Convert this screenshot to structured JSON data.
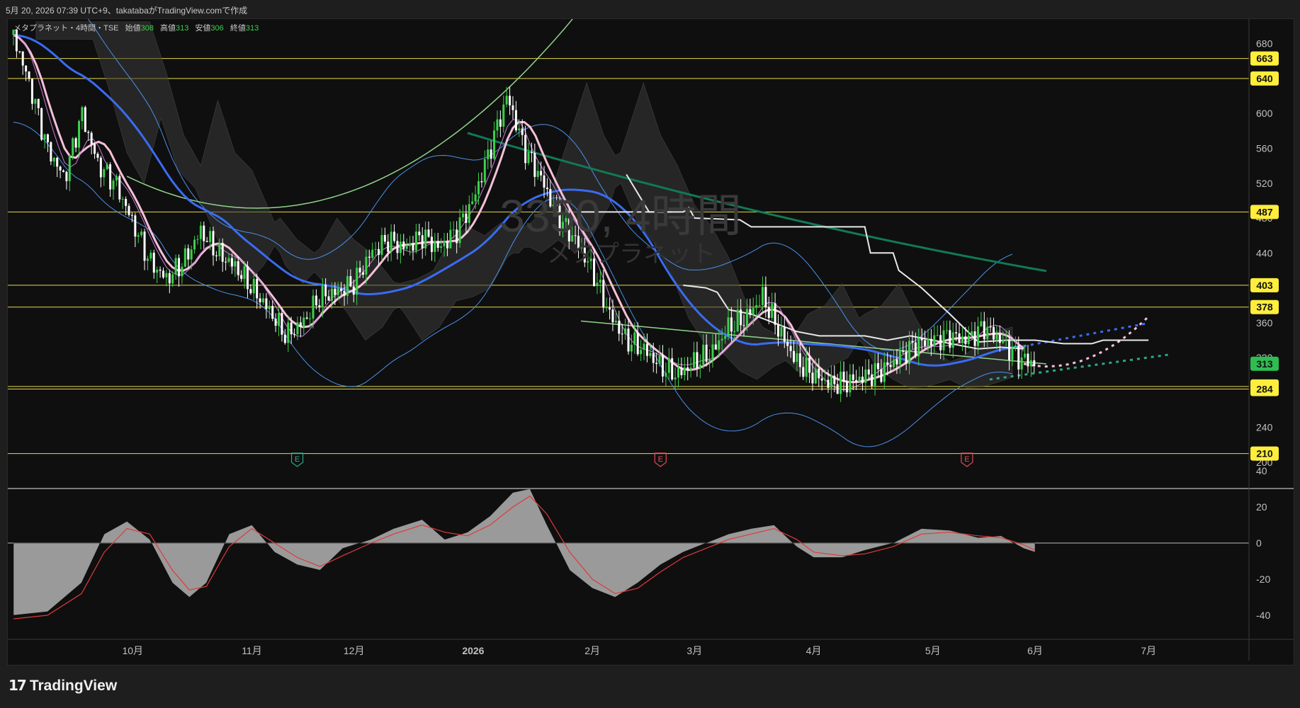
{
  "caption": "5月 20, 2026 07:39 UTC+9、takatabaがTradingView.comで作成",
  "logo": "TradingView",
  "legend": {
    "symbol": "メタプラネット・4時間・TSE",
    "open_label": "始値",
    "open": "308",
    "high_label": "高値",
    "high": "313",
    "low_label": "安値",
    "low": "306",
    "close_label": "終値",
    "close": "313"
  },
  "watermark": {
    "main": "3350, 4時間",
    "sub": "メタプラネット"
  },
  "earnings_marker": "E",
  "colors": {
    "level_line": "#e6d94a",
    "level_label_bg": "#ffee3c",
    "last_price_bg": "#2fbd52",
    "up": "#3bd14a",
    "down": "#ffffff",
    "ma_blue": "#3a6cf2",
    "ma_pink": "#f6c0d8",
    "ma_teal": "#117a55",
    "ma_lightgreen": "#8fd48a",
    "bollinger": "#4a90e8",
    "ichimoku_white": "#e8e8e8",
    "histogram": "#9a9a9a",
    "signal": "#e03a3a"
  },
  "chart_data": [
    {
      "type": "candlestick",
      "title": "メタプラネット・4時間・TSE",
      "y_axis_ticks": [
        680,
        600,
        560,
        520,
        440,
        360,
        240
      ],
      "y_axis_partial_ticks": [
        "480",
        "320",
        "200"
      ],
      "ylim": [
        200,
        700
      ],
      "x_axis_ticks": [
        "10月",
        "11月",
        "12月",
        "2026",
        "2月",
        "3月",
        "4月",
        "5月",
        "6月",
        "7月"
      ],
      "horizontal_levels": [
        663,
        640,
        487,
        403,
        378,
        287,
        284,
        210
      ],
      "last_price": 313,
      "ohlc_last": {
        "open": 308,
        "high": 313,
        "low": 306,
        "close": 313
      },
      "price_path": [
        [
          0,
          690
        ],
        [
          3,
          630
        ],
        [
          6,
          560
        ],
        [
          9,
          525
        ],
        [
          12,
          600
        ],
        [
          15,
          540
        ],
        [
          18,
          520
        ],
        [
          21,
          475
        ],
        [
          24,
          430
        ],
        [
          27,
          410
        ],
        [
          30,
          430
        ],
        [
          33,
          465
        ],
        [
          36,
          440
        ],
        [
          39,
          425
        ],
        [
          42,
          400
        ],
        [
          45,
          375
        ],
        [
          48,
          345
        ],
        [
          51,
          360
        ],
        [
          54,
          390
        ],
        [
          57,
          395
        ],
        [
          60,
          405
        ],
        [
          63,
          440
        ],
        [
          66,
          455
        ],
        [
          69,
          445
        ],
        [
          72,
          460
        ],
        [
          75,
          445
        ],
        [
          78,
          465
        ],
        [
          81,
          500
        ],
        [
          84,
          560
        ],
        [
          87,
          620
        ],
        [
          90,
          560
        ],
        [
          93,
          525
        ],
        [
          96,
          480
        ],
        [
          99,
          455
        ],
        [
          102,
          420
        ],
        [
          105,
          370
        ],
        [
          108,
          340
        ],
        [
          111,
          330
        ],
        [
          114,
          310
        ],
        [
          117,
          300
        ],
        [
          120,
          315
        ],
        [
          123,
          325
        ],
        [
          126,
          355
        ],
        [
          129,
          365
        ],
        [
          132,
          390
        ],
        [
          135,
          350
        ],
        [
          138,
          315
        ],
        [
          141,
          300
        ],
        [
          144,
          290
        ],
        [
          147,
          292
        ],
        [
          150,
          298
        ],
        [
          153,
          305
        ],
        [
          156,
          320
        ],
        [
          159,
          335
        ],
        [
          162,
          340
        ],
        [
          165,
          345
        ],
        [
          168,
          340
        ],
        [
          171,
          355
        ],
        [
          174,
          340
        ],
        [
          177,
          320
        ],
        [
          180,
          313
        ]
      ],
      "earnings_at": [
        50,
        114,
        168
      ]
    },
    {
      "type": "area",
      "title": "",
      "y_axis_ticks": [
        40,
        20,
        0,
        -20,
        -40
      ],
      "ylim": [
        -50,
        40
      ],
      "series": [
        {
          "values": [
            [
              0,
              -40
            ],
            [
              6,
              -38
            ],
            [
              12,
              -22
            ],
            [
              16,
              5
            ],
            [
              20,
              12
            ],
            [
              24,
              2
            ],
            [
              28,
              -22
            ],
            [
              31,
              -30
            ],
            [
              34,
              -22
            ],
            [
              38,
              5
            ],
            [
              42,
              10
            ],
            [
              46,
              -5
            ],
            [
              50,
              -12
            ],
            [
              54,
              -15
            ],
            [
              58,
              -3
            ],
            [
              63,
              2
            ],
            [
              67,
              8
            ],
            [
              72,
              13
            ],
            [
              76,
              2
            ],
            [
              80,
              6
            ],
            [
              84,
              15
            ],
            [
              88,
              28
            ],
            [
              91,
              30
            ],
            [
              94,
              10
            ],
            [
              98,
              -15
            ],
            [
              102,
              -25
            ],
            [
              106,
              -30
            ],
            [
              110,
              -22
            ],
            [
              114,
              -12
            ],
            [
              118,
              -5
            ],
            [
              122,
              0
            ],
            [
              126,
              5
            ],
            [
              130,
              8
            ],
            [
              134,
              10
            ],
            [
              138,
              -2
            ],
            [
              141,
              -8
            ],
            [
              146,
              -8
            ],
            [
              150,
              -4
            ],
            [
              155,
              0
            ],
            [
              160,
              8
            ],
            [
              165,
              7
            ],
            [
              170,
              3
            ],
            [
              174,
              4
            ],
            [
              178,
              -3
            ],
            [
              180,
              -5
            ]
          ]
        },
        {
          "values": [
            [
              0,
              -42
            ],
            [
              6,
              -40
            ],
            [
              12,
              -28
            ],
            [
              16,
              -5
            ],
            [
              20,
              8
            ],
            [
              24,
              5
            ],
            [
              28,
              -15
            ],
            [
              31,
              -26
            ],
            [
              34,
              -24
            ],
            [
              38,
              -2
            ],
            [
              42,
              8
            ],
            [
              46,
              0
            ],
            [
              50,
              -8
            ],
            [
              54,
              -13
            ],
            [
              58,
              -7
            ],
            [
              63,
              0
            ],
            [
              67,
              5
            ],
            [
              72,
              10
            ],
            [
              76,
              6
            ],
            [
              80,
              4
            ],
            [
              84,
              10
            ],
            [
              88,
              20
            ],
            [
              91,
              26
            ],
            [
              94,
              16
            ],
            [
              98,
              -5
            ],
            [
              102,
              -20
            ],
            [
              106,
              -28
            ],
            [
              110,
              -25
            ],
            [
              114,
              -16
            ],
            [
              118,
              -8
            ],
            [
              122,
              -3
            ],
            [
              126,
              2
            ],
            [
              130,
              5
            ],
            [
              134,
              8
            ],
            [
              138,
              2
            ],
            [
              141,
              -5
            ],
            [
              146,
              -7
            ],
            [
              150,
              -6
            ],
            [
              155,
              -2
            ],
            [
              160,
              5
            ],
            [
              165,
              6
            ],
            [
              170,
              4
            ],
            [
              174,
              3
            ],
            [
              178,
              -1
            ],
            [
              180,
              -4
            ]
          ]
        }
      ]
    }
  ]
}
